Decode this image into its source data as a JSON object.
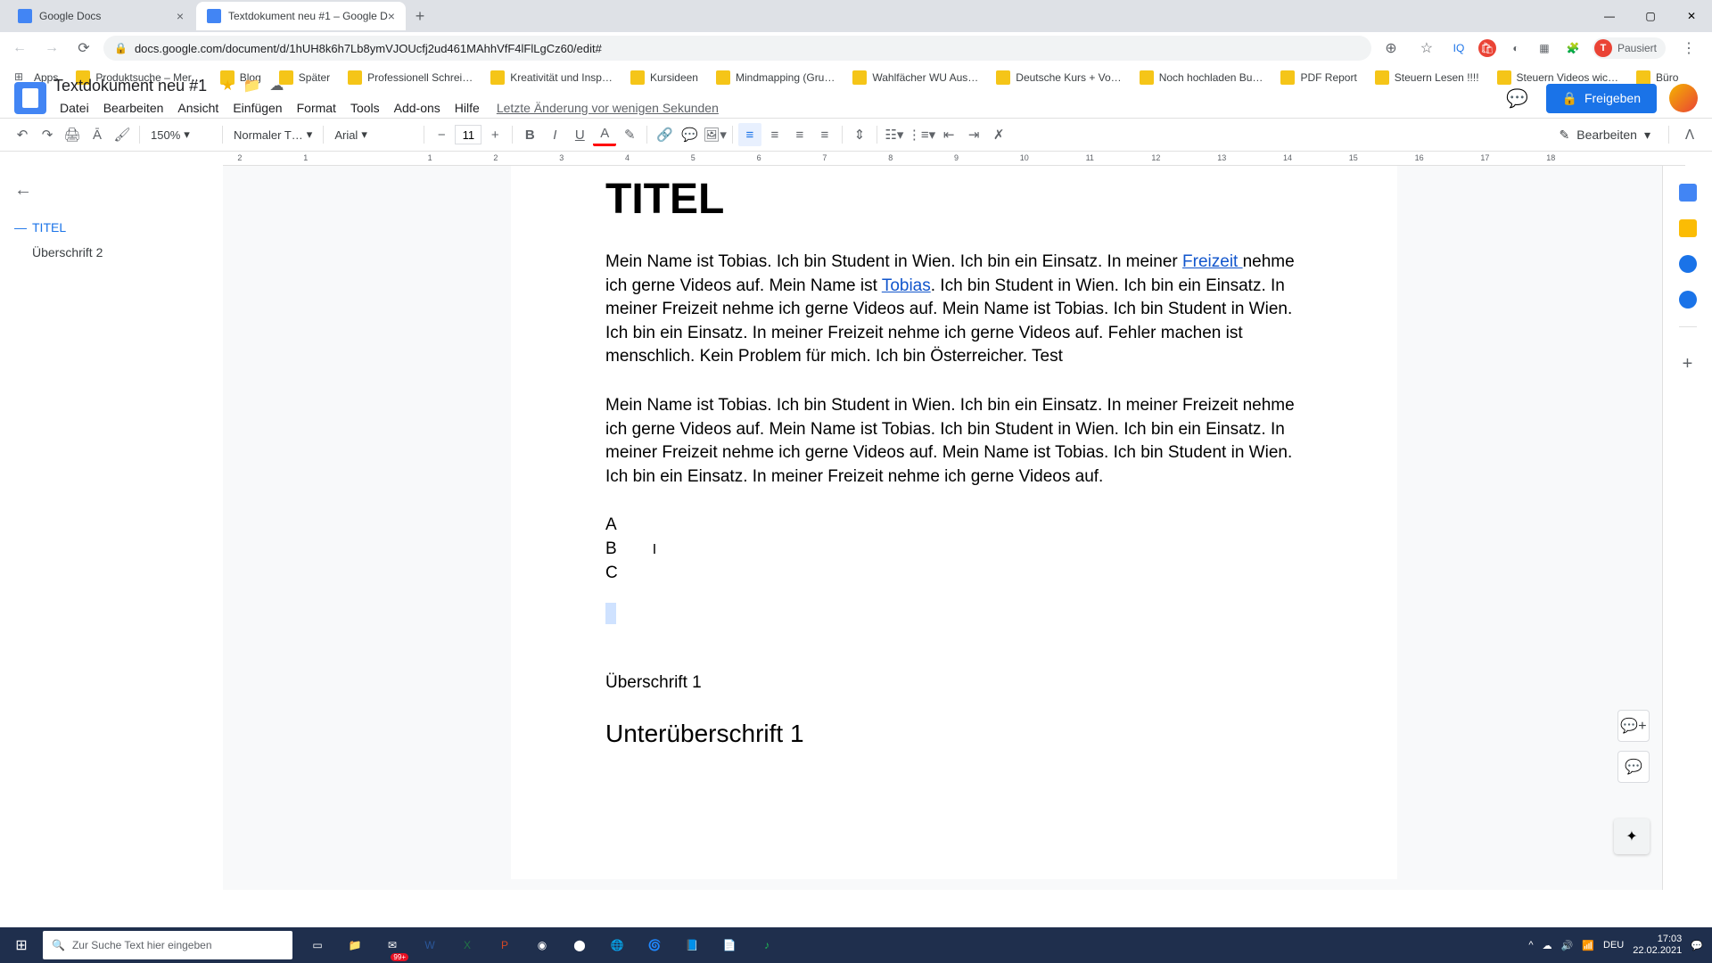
{
  "browser": {
    "tabs": [
      {
        "title": "Google Docs",
        "active": false
      },
      {
        "title": "Textdokument neu #1 – Google D",
        "active": true
      }
    ],
    "url": "docs.google.com/document/d/1hUH8k6h7Lb8ymVJOUcfj2ud461MAhhVfF4lFlLgCz60/edit#",
    "profile_status": "Pausiert",
    "profile_initial": "T",
    "bookmarks": [
      "Apps",
      "Produktsuche – Mer…",
      "Blog",
      "Später",
      "Professionell Schrei…",
      "Kreativität und Insp…",
      "Kursideen",
      "Mindmapping (Gru…",
      "Wahlfächer WU Aus…",
      "Deutsche Kurs + Vo…",
      "Noch hochladen Bu…",
      "PDF Report",
      "Steuern Lesen !!!!",
      "Steuern Videos wic…",
      "Büro"
    ]
  },
  "docs": {
    "title": "Textdokument neu #1",
    "last_edit": "Letzte Änderung vor wenigen Sekunden",
    "share_label": "Freigeben",
    "menus": [
      "Datei",
      "Bearbeiten",
      "Ansicht",
      "Einfügen",
      "Format",
      "Tools",
      "Add-ons",
      "Hilfe"
    ],
    "toolbar": {
      "zoom": "150%",
      "style": "Normaler T…",
      "font": "Arial",
      "font_size": "11",
      "edit_mode": "Bearbeiten"
    },
    "outline": [
      {
        "label": "TITEL",
        "active": true
      },
      {
        "label": "Überschrift 2",
        "active": false
      }
    ]
  },
  "document": {
    "title": "TITEL",
    "para1_pre": "Mein Name ist Tobias. Ich bin Student in Wien. Ich bin ein Einsatz. In meiner ",
    "link1": "Freizeit ",
    "para1_mid": "nehme ich gerne Videos auf. Mein Name ist ",
    "link2": "Tobias",
    "para1_post": ". Ich bin Student in Wien. Ich bin ein Einsatz. In meiner Freizeit nehme ich gerne Videos auf. Mein Name ist Tobias. Ich bin Student in Wien. Ich bin ein Einsatz. In meiner Freizeit nehme ich gerne Videos auf. Fehler machen ist menschlich. Kein Problem für mich. Ich bin Österreicher. Test",
    "para2": "Mein Name ist Tobias. Ich bin Student in Wien. Ich bin ein Einsatz. In meiner Freizeit nehme ich gerne Videos auf. Mein Name ist Tobias. Ich bin Student in Wien. Ich bin ein Einsatz. In meiner Freizeit nehme ich gerne Videos auf. Mein Name ist Tobias. Ich bin Student in Wien. Ich bin ein Einsatz. In meiner Freizeit nehme ich gerne Videos auf.",
    "list": [
      "A",
      "B",
      "C"
    ],
    "h1": "Überschrift 1",
    "h2": "Unterüberschrift 1"
  },
  "ruler_ticks": [
    "2",
    "1",
    "",
    "1",
    "2",
    "3",
    "4",
    "5",
    "6",
    "7",
    "8",
    "9",
    "10",
    "11",
    "12",
    "13",
    "14",
    "15",
    "16",
    "17",
    "18"
  ],
  "taskbar": {
    "search_placeholder": "Zur Suche Text hier eingeben",
    "lang": "DEU",
    "time": "17:03",
    "date": "22.02.2021",
    "badge": "99+"
  }
}
